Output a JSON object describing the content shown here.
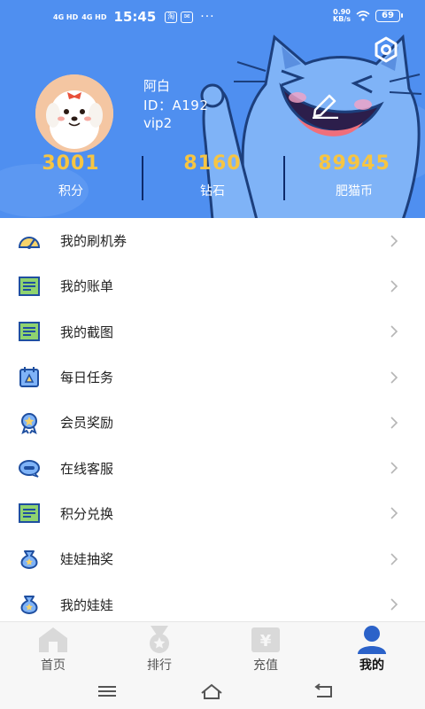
{
  "status_bar": {
    "sig1": "4G HD",
    "sig2": "4G HD",
    "time": "15:45",
    "badge1": "淘",
    "badge2": "✉",
    "dots": "···",
    "net_speed": "0.90",
    "net_unit": "KB/s",
    "battery": "69"
  },
  "profile": {
    "name": "阿白",
    "id": "ID：A192",
    "vip": "vip2"
  },
  "stats": [
    {
      "value": "3001",
      "label": "积分"
    },
    {
      "value": "8160",
      "label": "钻石"
    },
    {
      "value": "89945",
      "label": "肥猫币"
    }
  ],
  "menu": [
    {
      "label": "我的刷机券",
      "icon": "gauge-icon"
    },
    {
      "label": "我的账单",
      "icon": "bill-icon"
    },
    {
      "label": "我的截图",
      "icon": "screenshot-icon"
    },
    {
      "label": "每日任务",
      "icon": "calendar-task-icon"
    },
    {
      "label": "会员奖励",
      "icon": "badge-award-icon"
    },
    {
      "label": "在线客服",
      "icon": "chat-service-icon"
    },
    {
      "label": "积分兑换",
      "icon": "exchange-icon"
    },
    {
      "label": "娃娃抽奖",
      "icon": "money-bag-icon"
    },
    {
      "label": "我的娃娃",
      "icon": "doll-bag-icon"
    }
  ],
  "tabs": [
    {
      "label": "首页",
      "icon": "home-icon",
      "active": false
    },
    {
      "label": "排行",
      "icon": "medal-icon",
      "active": false
    },
    {
      "label": "充值",
      "icon": "yen-recharge-icon",
      "active": false
    },
    {
      "label": "我的",
      "icon": "user-icon",
      "active": true
    }
  ],
  "colors": {
    "header_bg": "#4f8ff0",
    "stat_value": "#f6c543",
    "menu_icon": "#1f4fa0",
    "tab_inactive": "#d9d9d9",
    "tab_active": "#2b62c9"
  }
}
